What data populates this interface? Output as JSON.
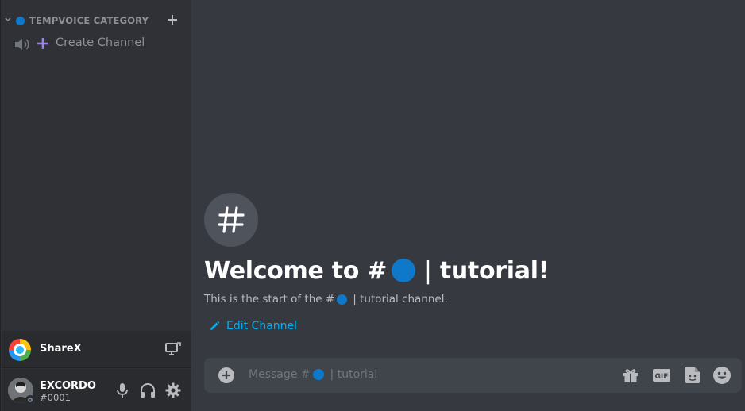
{
  "sidebar": {
    "category": {
      "label": "TEMPVOICE CATEGORY",
      "dot_color": "#0f78c9"
    },
    "channel": {
      "label": "Create Channel",
      "icon": "speaker-icon",
      "prefix_icon": "plus-icon"
    }
  },
  "sharex": {
    "label": "ShareX",
    "icon": "screen-share-icon"
  },
  "user": {
    "name": "EXCORDO",
    "discriminator": "#0001",
    "status": "offline"
  },
  "main": {
    "welcome_prefix": "Welcome to #",
    "welcome_suffix": "| tutorial!",
    "subtitle_prefix": "This is the start of the #",
    "subtitle_suffix": "| tutorial channel.",
    "edit_channel": "Edit Channel",
    "channel_dot_color": "#0f78c9"
  },
  "composer": {
    "placeholder_prefix": "Message #",
    "placeholder_suffix": "| tutorial",
    "gif_label": "GIF",
    "icons": [
      "add-circle-icon",
      "gift-icon",
      "gif-icon",
      "sticker-icon",
      "emoji-icon"
    ]
  },
  "colors": {
    "accent": "#0f78c9",
    "link": "#00b0f4",
    "sidebar_bg": "#2f3136",
    "main_bg": "#36393f"
  }
}
